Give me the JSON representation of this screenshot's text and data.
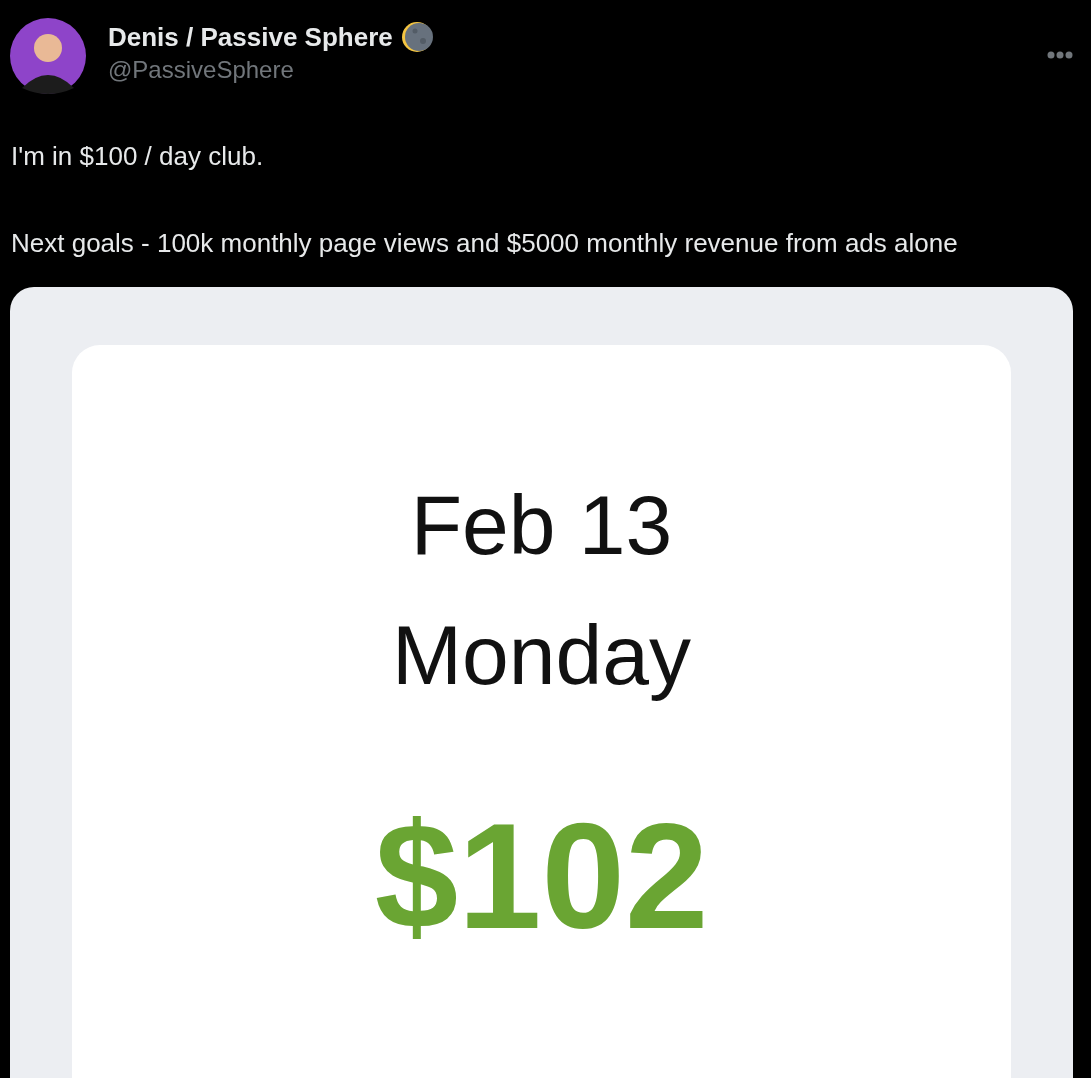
{
  "tweet": {
    "author_name": "Denis / Passive Sphere",
    "handle": "@PassiveSphere",
    "text": [
      "I'm in $100 / day club.",
      "Next goals - 100k monthly page views and $5000 monthly revenue from ads alone"
    ],
    "image": {
      "date": "Feb 13",
      "weekday": "Monday",
      "amount": "$102"
    }
  }
}
